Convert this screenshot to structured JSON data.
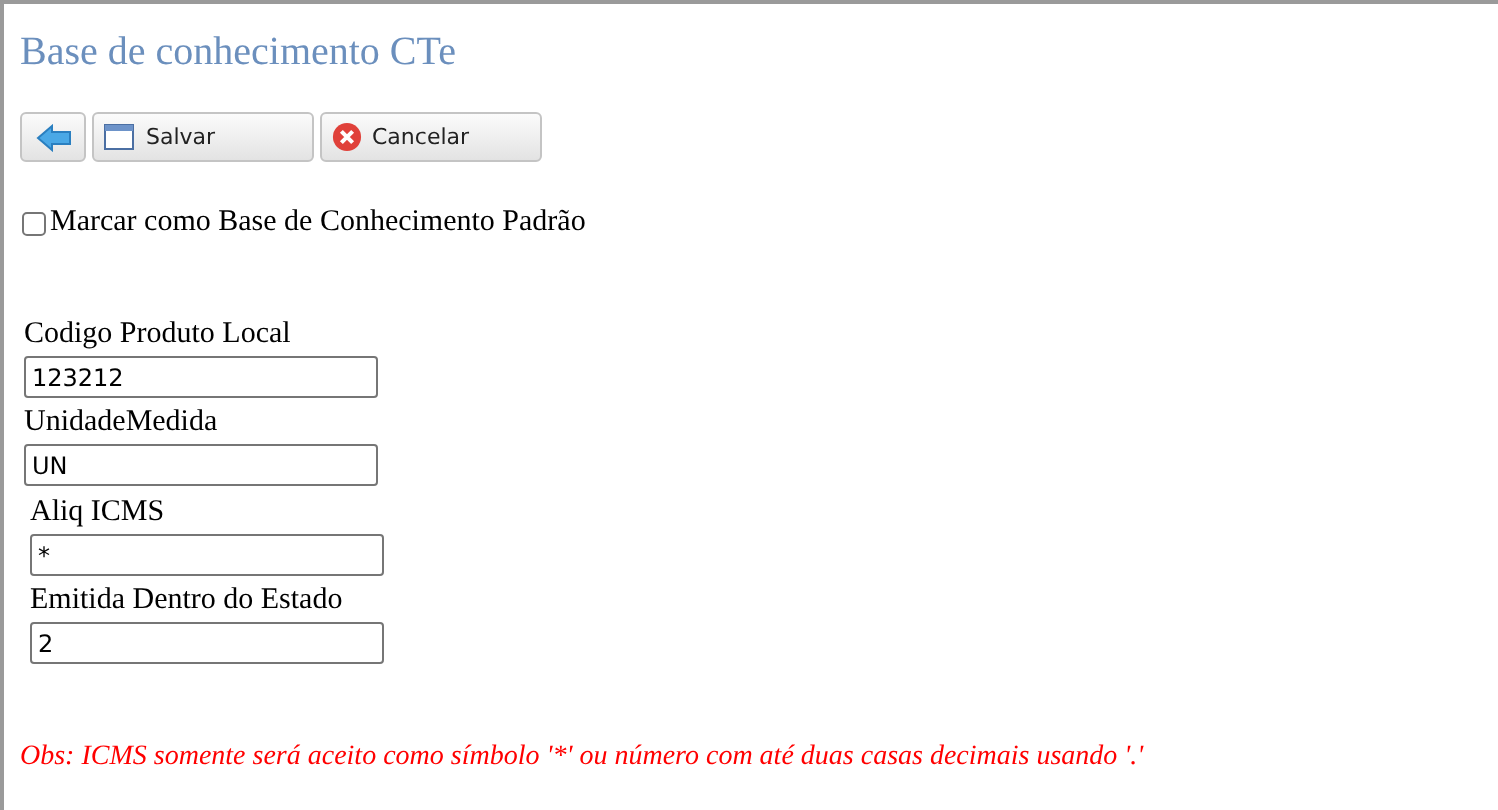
{
  "title": "Base de conhecimento CTe",
  "toolbar": [
    {
      "kind": "back"
    },
    {
      "kind": "save",
      "label": "Salvar"
    },
    {
      "kind": "cancel",
      "label": "Cancelar"
    }
  ],
  "default_checkbox": {
    "label": "Marcar como Base de Conhecimento Padrão",
    "checked": false
  },
  "field_groups": [
    {
      "fields": [
        {
          "label": "Codigo Produto Local",
          "value": "123212"
        },
        {
          "label": "UnidadeMedida",
          "value": "UN"
        }
      ]
    },
    {
      "fields": [
        {
          "label": "Aliq ICMS",
          "value": "*"
        },
        {
          "label": "Emitida Dentro do Estado",
          "value": "2"
        }
      ]
    }
  ],
  "note": "Obs: ICMS somente será aceito como símbolo '*' ou número com até duas casas decimais usando '.'"
}
